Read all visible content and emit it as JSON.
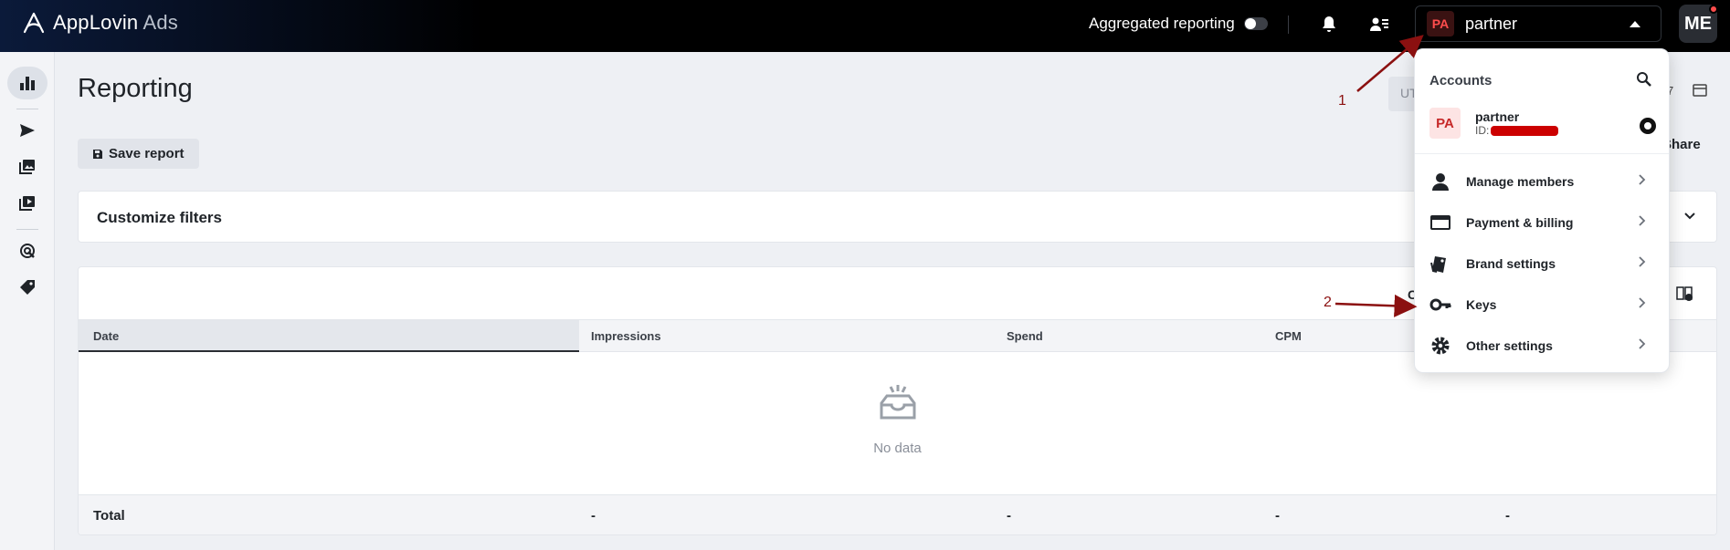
{
  "app": {
    "brand_name": "AppLovin",
    "brand_suffix": "Ads",
    "aggregated_label": "Aggregated reporting",
    "account_initials": "PA",
    "account_name": "partner",
    "user_initials": "ME"
  },
  "page": {
    "title": "Reporting",
    "save_label": "Save report",
    "timezone_fragment": "UT",
    "date_fragment": "7",
    "share_label": "Share",
    "filters_label": "Customize filters",
    "columns_fragment": "C"
  },
  "table": {
    "headers": [
      "Date",
      "Impressions",
      "Spend",
      "CPM"
    ],
    "empty_text": "No data",
    "total_label": "Total",
    "total_values": [
      "-",
      "-",
      "-",
      "-"
    ]
  },
  "dropdown": {
    "title": "Accounts",
    "account_initials": "PA",
    "account_name": "partner",
    "account_id_label": "ID:",
    "items": [
      {
        "label": "Manage members",
        "icon": "person-icon"
      },
      {
        "label": "Payment & billing",
        "icon": "credit-card-icon"
      },
      {
        "label": "Brand settings",
        "icon": "brand-tag-icon"
      },
      {
        "label": "Keys",
        "icon": "key-icon"
      },
      {
        "label": "Other settings",
        "icon": "gear-icon"
      }
    ]
  },
  "annotations": {
    "step1": "1",
    "step2": "2"
  },
  "colors": {
    "topbar": "#000000",
    "accent_red": "#ff4d4d",
    "annotation": "#8b1010"
  }
}
